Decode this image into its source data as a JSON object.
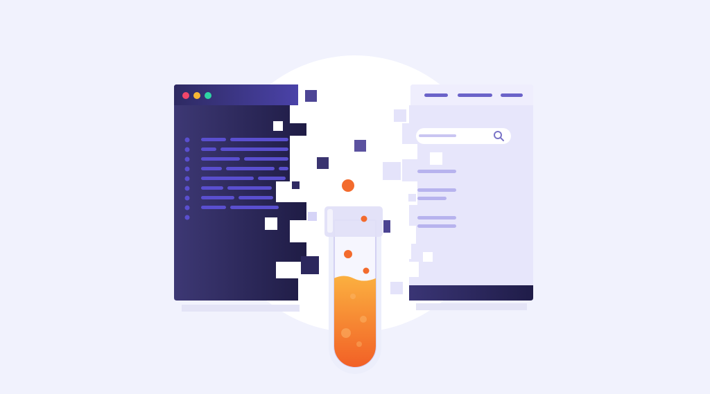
{
  "illustration": {
    "subject": "code-editor-to-browser-transform-with-test-tube",
    "icons": [
      "search-icon",
      "test-tube-icon"
    ]
  },
  "colors": {
    "background": "#f1f2fd",
    "circle": "#ffffff",
    "editor_dark": "#2a2550",
    "editor_light": "#3b3670",
    "titlebar_dark": "#332e68",
    "titlebar_light": "#4b43a3",
    "code_line": "#5a4fcf",
    "browser_body": "#e7e6fb",
    "browser_header": "#eeedfc",
    "browser_line": "#b7b3ee",
    "browser_footer": "#2d2960",
    "dot_red": "#f2466a",
    "dot_yellow": "#f7b734",
    "dot_green": "#2ed4a4",
    "liquid_top": "#f9a23a",
    "liquid_bottom": "#f15a24",
    "bubble": "#f36b2d"
  }
}
